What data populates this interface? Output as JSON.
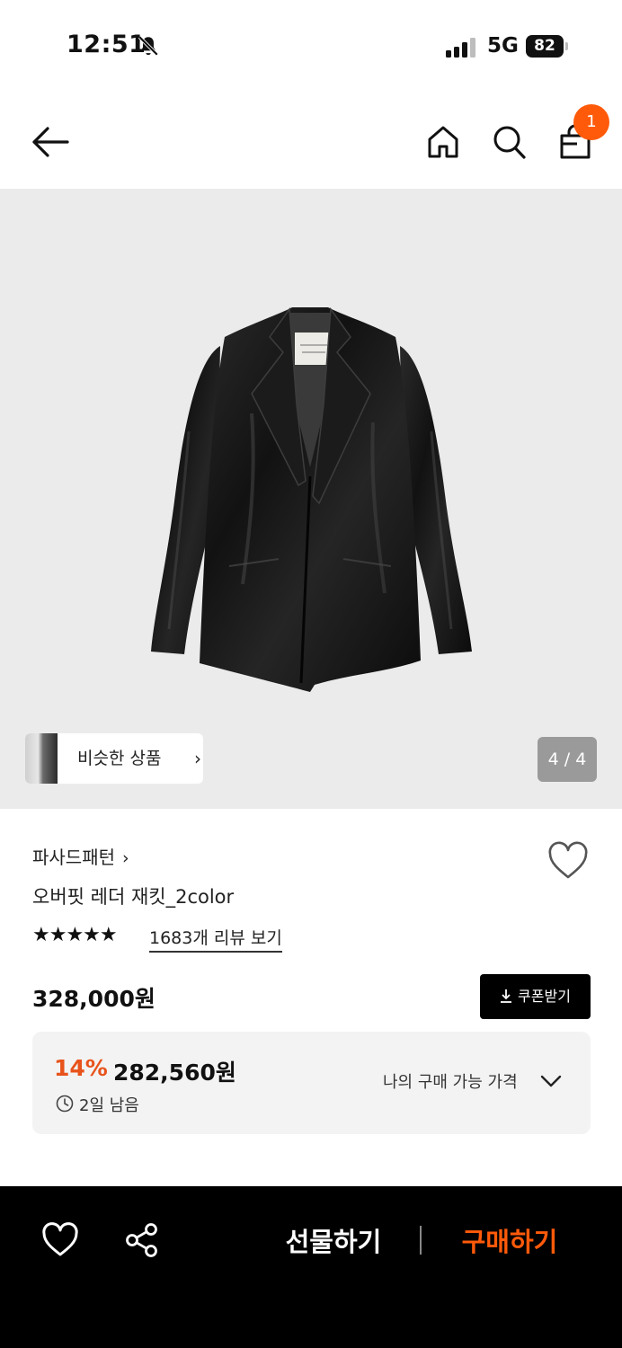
{
  "status_bar": {
    "time": "12:51",
    "network": "5G",
    "battery": "82",
    "icons": [
      "bell-slash-icon",
      "signal-icon",
      "battery-icon"
    ]
  },
  "header": {
    "icons": [
      "arrow-left-icon",
      "home-icon",
      "search-icon",
      "shopping-bag-icon"
    ],
    "cart_count": "1"
  },
  "gallery": {
    "similar_label": "비슷한 상품",
    "similar_chevron": "›",
    "page_indicator": "4 / 4"
  },
  "product": {
    "brand": "파사드패턴",
    "brand_chevron": "›",
    "name": "오버핏 레더 재킷_2color",
    "stars": "★★★★★",
    "rating": 5,
    "review_link": "1683개 리뷰 보기",
    "price": "328,000원",
    "coupon_label": "쿠폰받기",
    "discount": {
      "percent": "14%",
      "price": "282,560원",
      "remaining": "2일 남음",
      "my_price_label": "나의 구매 가능 가격"
    }
  },
  "bottom_bar": {
    "gift_label": "선물하기",
    "buy_label": "구매하기"
  },
  "colors": {
    "accent": "#ff5a0a",
    "discount": "#e8531c",
    "gallery_bg": "#ebebeb",
    "bottom_bar_bg": "#000000"
  }
}
